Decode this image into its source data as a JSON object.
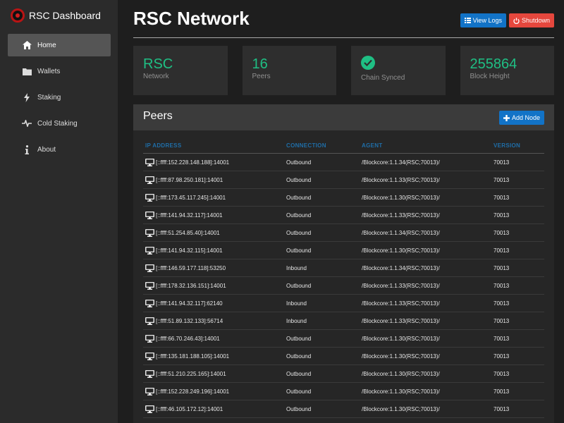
{
  "brand": {
    "title": "RSC Dashboard"
  },
  "sidebar": {
    "items": [
      {
        "label": "Home",
        "icon": "home-icon"
      },
      {
        "label": "Wallets",
        "icon": "folder-icon"
      },
      {
        "label": "Staking",
        "icon": "bolt-icon"
      },
      {
        "label": "Cold Staking",
        "icon": "pulse-icon"
      },
      {
        "label": "About",
        "icon": "info-icon"
      }
    ]
  },
  "header": {
    "title": "RSC Network",
    "view_logs": "View Logs",
    "shutdown": "Shutdown"
  },
  "cards": [
    {
      "value": "RSC",
      "label": "Network"
    },
    {
      "value": "16",
      "label": "Peers"
    },
    {
      "value": "",
      "label": "Chain Synced",
      "icon": "check-circle-icon"
    },
    {
      "value": "255864",
      "label": "Block Height"
    }
  ],
  "peers": {
    "title": "Peers",
    "add_node": "Add Node",
    "columns": [
      "IP ADDRESS",
      "CONNECTION",
      "AGENT",
      "VERSION"
    ],
    "rows": [
      [
        "[::ffff:152.228.148.188]:14001",
        "Outbound",
        "/Blockcore:1.1.34(RSC;70013)/",
        "70013"
      ],
      [
        "[::ffff:87.98.250.181]:14001",
        "Outbound",
        "/Blockcore:1.1.33(RSC;70013)/",
        "70013"
      ],
      [
        "[::ffff:173.45.117.245]:14001",
        "Outbound",
        "/Blockcore:1.1.30(RSC;70013)/",
        "70013"
      ],
      [
        "[::ffff:141.94.32.117]:14001",
        "Outbound",
        "/Blockcore:1.1.33(RSC;70013)/",
        "70013"
      ],
      [
        "[::ffff:51.254.85.40]:14001",
        "Outbound",
        "/Blockcore:1.1.34(RSC;70013)/",
        "70013"
      ],
      [
        "[::ffff:141.94.32.115]:14001",
        "Outbound",
        "/Blockcore:1.1.30(RSC;70013)/",
        "70013"
      ],
      [
        "[::ffff:146.59.177.118]:53250",
        "Inbound",
        "/Blockcore:1.1.34(RSC;70013)/",
        "70013"
      ],
      [
        "[::ffff:178.32.136.151]:14001",
        "Outbound",
        "/Blockcore:1.1.33(RSC;70013)/",
        "70013"
      ],
      [
        "[::ffff:141.94.32.117]:62140",
        "Inbound",
        "/Blockcore:1.1.33(RSC;70013)/",
        "70013"
      ],
      [
        "[::ffff:51.89.132.133]:56714",
        "Inbound",
        "/Blockcore:1.1.33(RSC;70013)/",
        "70013"
      ],
      [
        "[::ffff:66.70.246.43]:14001",
        "Outbound",
        "/Blockcore:1.1.30(RSC;70013)/",
        "70013"
      ],
      [
        "[::ffff:135.181.188.105]:14001",
        "Outbound",
        "/Blockcore:1.1.30(RSC;70013)/",
        "70013"
      ],
      [
        "[::ffff:51.210.225.165]:14001",
        "Outbound",
        "/Blockcore:1.1.30(RSC;70013)/",
        "70013"
      ],
      [
        "[::ffff:152.228.249.196]:14001",
        "Outbound",
        "/Blockcore:1.1.30(RSC;70013)/",
        "70013"
      ],
      [
        "[::ffff:46.105.172.12]:14001",
        "Outbound",
        "/Blockcore:1.1.30(RSC;70013)/",
        "70013"
      ]
    ]
  },
  "colors": {
    "accent": "#1fbf84",
    "primary": "#1273c7",
    "danger": "#e5473d"
  }
}
